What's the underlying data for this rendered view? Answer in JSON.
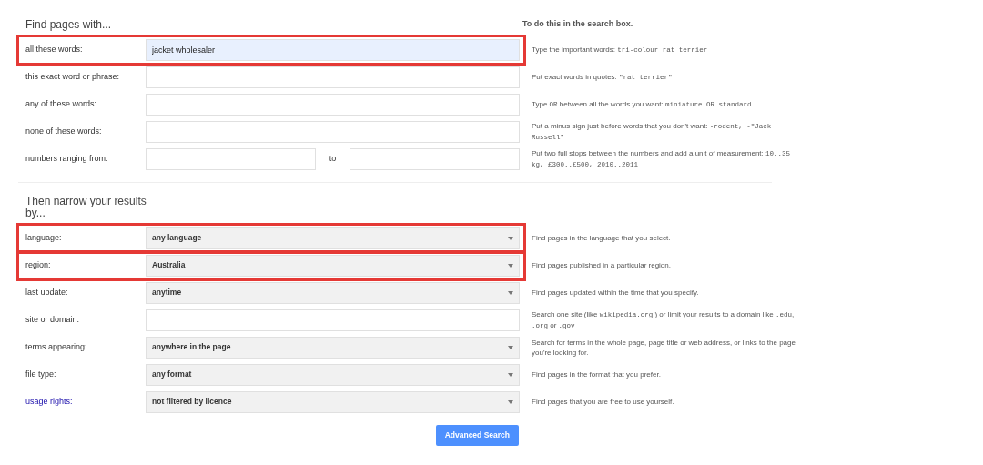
{
  "sections": [
    {
      "title": "Find pages with...",
      "aside_title": "To do this in the search box.",
      "rows": [
        {
          "label": "all these words:",
          "kind": "text",
          "value": "jacket wholesaler",
          "highlighted": true,
          "link": false,
          "hint": [
            {
              "kind": "text",
              "text": "Type the important words: "
            },
            {
              "kind": "code",
              "text": "tri-colour rat terrier"
            }
          ]
        },
        {
          "label": "this exact word or phrase:",
          "kind": "text",
          "value": "",
          "highlighted": false,
          "link": false,
          "hint": [
            {
              "kind": "text",
              "text": "Put exact words in quotes: "
            },
            {
              "kind": "code",
              "text": "\"rat terrier\""
            }
          ]
        },
        {
          "label": "any of these words:",
          "kind": "text",
          "value": "",
          "highlighted": false,
          "link": false,
          "hint": [
            {
              "kind": "text",
              "text": "Type "
            },
            {
              "kind": "code",
              "text": "OR"
            },
            {
              "kind": "text",
              "text": " between all the words you want: "
            },
            {
              "kind": "code",
              "text": "miniature OR standard"
            }
          ]
        },
        {
          "label": "none of these words:",
          "kind": "text",
          "value": "",
          "highlighted": false,
          "link": false,
          "hint": [
            {
              "kind": "text",
              "text": "Put a minus sign just before words that you don't want: "
            },
            {
              "kind": "code",
              "text": "-rodent, -\"Jack Russell\""
            }
          ]
        },
        {
          "label": "numbers ranging from:",
          "kind": "range",
          "value": "",
          "to_label": "to",
          "highlighted": false,
          "link": false,
          "hint": [
            {
              "kind": "text",
              "text": "Put two full stops between the numbers and add a unit of measurement: "
            },
            {
              "kind": "code",
              "text": "10..35 kg, £300..£500, 2010..2011"
            }
          ]
        }
      ]
    },
    {
      "title": "Then narrow your results by...",
      "rows": [
        {
          "label": "language:",
          "kind": "select",
          "value": "any language",
          "highlighted": true,
          "link": false,
          "hint": [
            {
              "kind": "text",
              "text": "Find pages in the language that you select."
            }
          ]
        },
        {
          "label": "region:",
          "kind": "select",
          "value": "Australia",
          "highlighted": true,
          "link": false,
          "hint": [
            {
              "kind": "text",
              "text": "Find pages published in a particular region."
            }
          ]
        },
        {
          "label": "last update:",
          "kind": "select",
          "value": "anytime",
          "highlighted": false,
          "link": false,
          "hint": [
            {
              "kind": "text",
              "text": "Find pages updated within the time that you specify."
            }
          ]
        },
        {
          "label": "site or domain:",
          "kind": "text",
          "value": "",
          "highlighted": false,
          "link": false,
          "hint": [
            {
              "kind": "text",
              "text": "Search one site (like "
            },
            {
              "kind": "code",
              "text": "wikipedia.org"
            },
            {
              "kind": "text",
              "text": " ) or limit your results to a domain like "
            },
            {
              "kind": "code",
              "text": ".edu"
            },
            {
              "kind": "text",
              "text": ", "
            },
            {
              "kind": "code",
              "text": ".org"
            },
            {
              "kind": "text",
              "text": " or "
            },
            {
              "kind": "code",
              "text": ".gov"
            }
          ]
        },
        {
          "label": "terms appearing:",
          "kind": "select",
          "value": "anywhere in the page",
          "highlighted": false,
          "link": false,
          "hint": [
            {
              "kind": "text",
              "text": "Search for terms in the whole page, page title or web address, or links to the page you're looking for."
            }
          ]
        },
        {
          "label": "file type:",
          "kind": "select",
          "value": "any format",
          "highlighted": false,
          "link": false,
          "hint": [
            {
              "kind": "text",
              "text": "Find pages in the format that you prefer."
            }
          ]
        },
        {
          "label": "usage rights:",
          "kind": "select",
          "value": "not filtered by licence",
          "highlighted": false,
          "link": true,
          "hint": [
            {
              "kind": "text",
              "text": "Find pages that you are free to use yourself."
            }
          ]
        }
      ]
    }
  ],
  "submit": "Advanced Search"
}
